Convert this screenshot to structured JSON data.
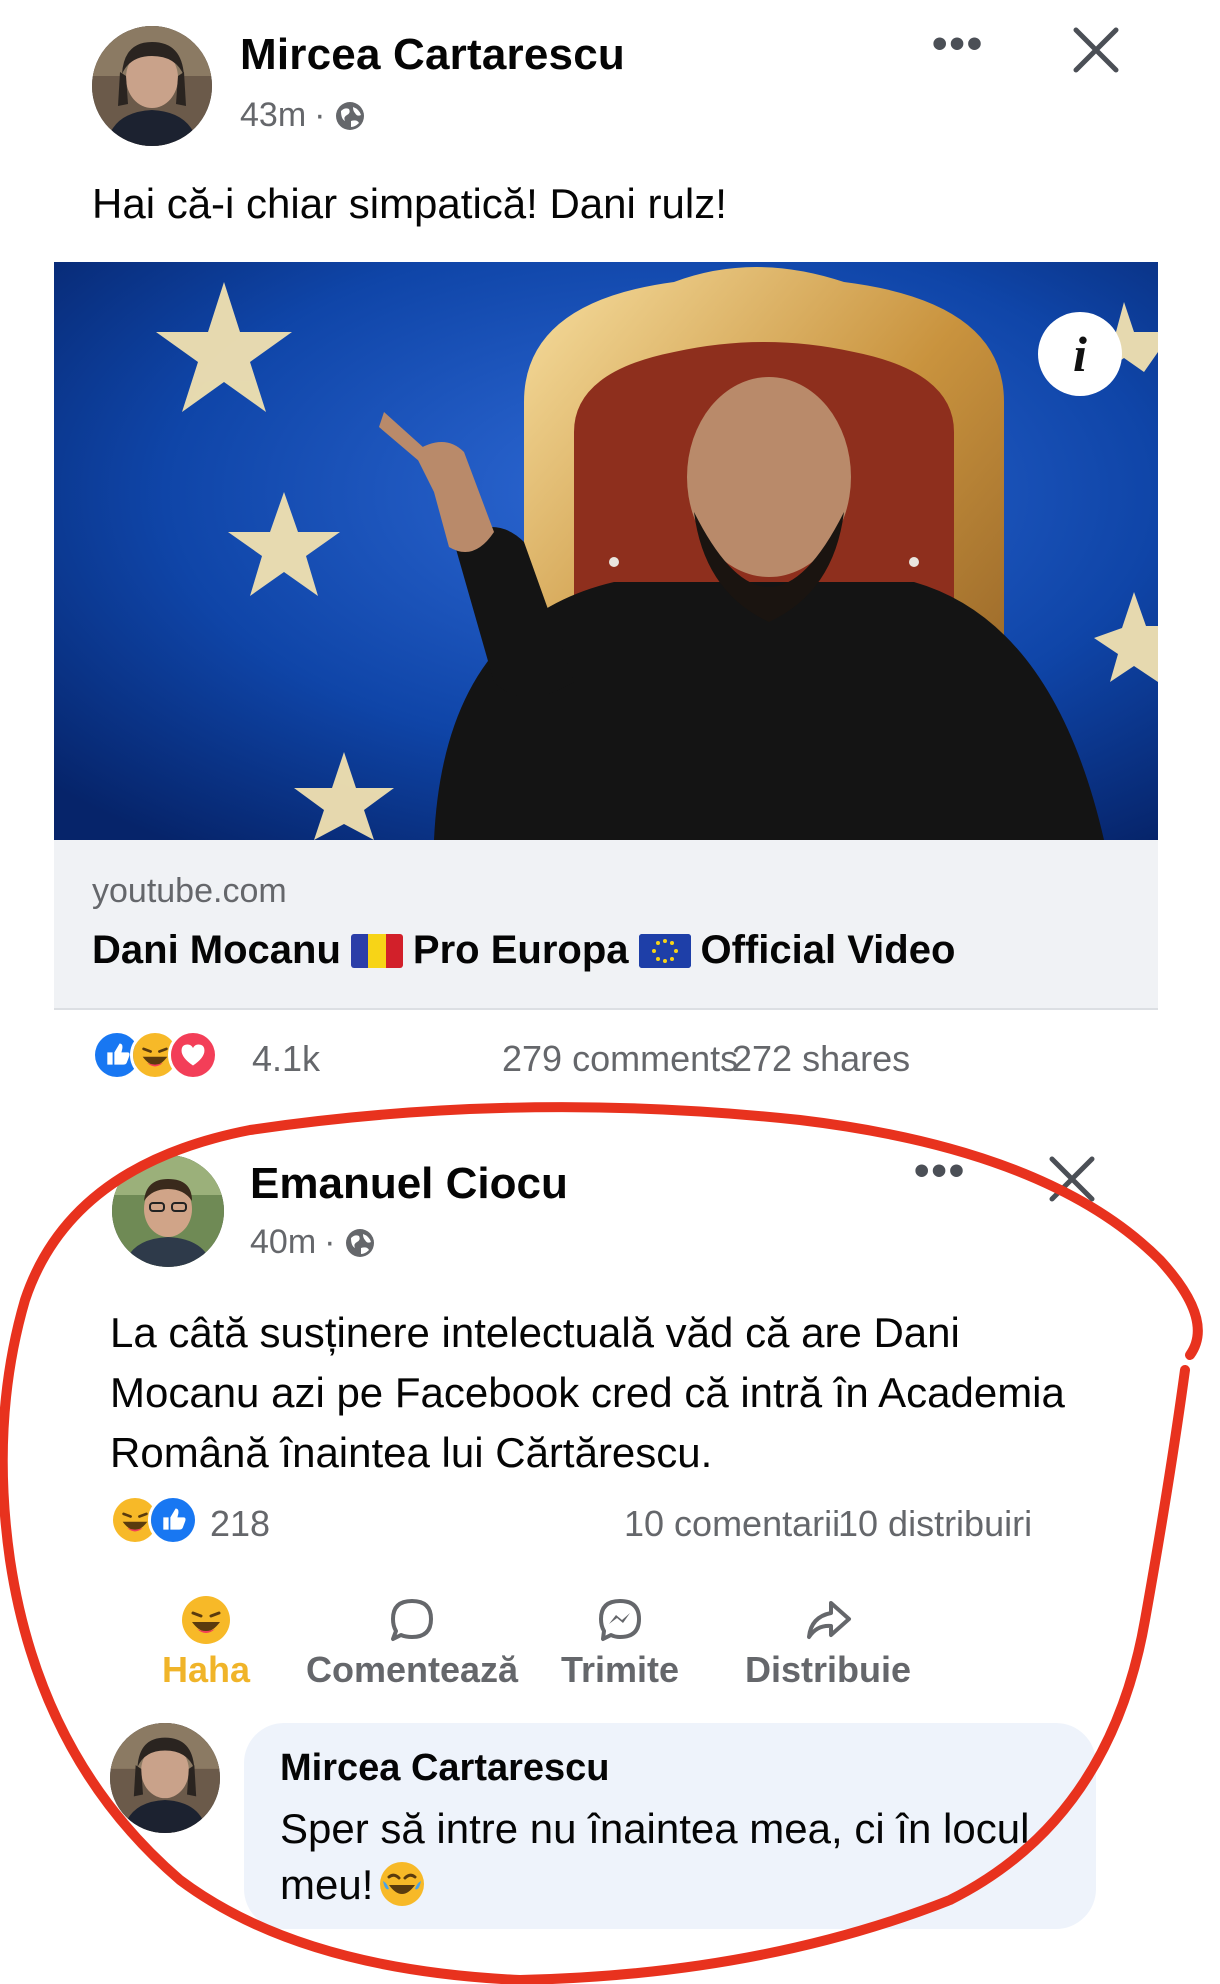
{
  "post1": {
    "author": "Mircea Cartarescu",
    "time": "43m",
    "separator": "·",
    "text": "Hai că-i chiar simpatică! Dani rulz!",
    "more_icon": "more-dots-icon",
    "close_icon": "close-icon",
    "link": {
      "domain": "youtube.com",
      "title_part1": "Dani Mocanu",
      "title_part2": "Pro Europa",
      "title_part3": "Official Video"
    },
    "reaction_count": "4.1k",
    "comments": "279 comments",
    "shares": "272 shares"
  },
  "post2": {
    "author": "Emanuel Ciocu",
    "time": "40m",
    "separator": "·",
    "text": "La câtă susținere intelectuală văd că are Dani Mocanu azi pe Facebook cred că intră în Academia Română înaintea lui Cărtărescu.",
    "reaction_count": "218",
    "comments": "10 comentarii",
    "shares": "10 distribuiri",
    "actions": {
      "haha": "Haha",
      "comment": "Comentează",
      "send": "Trimite",
      "share": "Distribuie"
    }
  },
  "comment": {
    "author": "Mircea Cartarescu",
    "text": "Sper să intre nu înaintea mea, ci în locul meu!"
  },
  "colors": {
    "facebook_blue": "#1877f2",
    "love_red": "#f33e58",
    "haha_yellow": "#f7b928",
    "marker_red": "#e8321e",
    "secondary_text": "#65676b",
    "bubble": "#eef3fb"
  }
}
